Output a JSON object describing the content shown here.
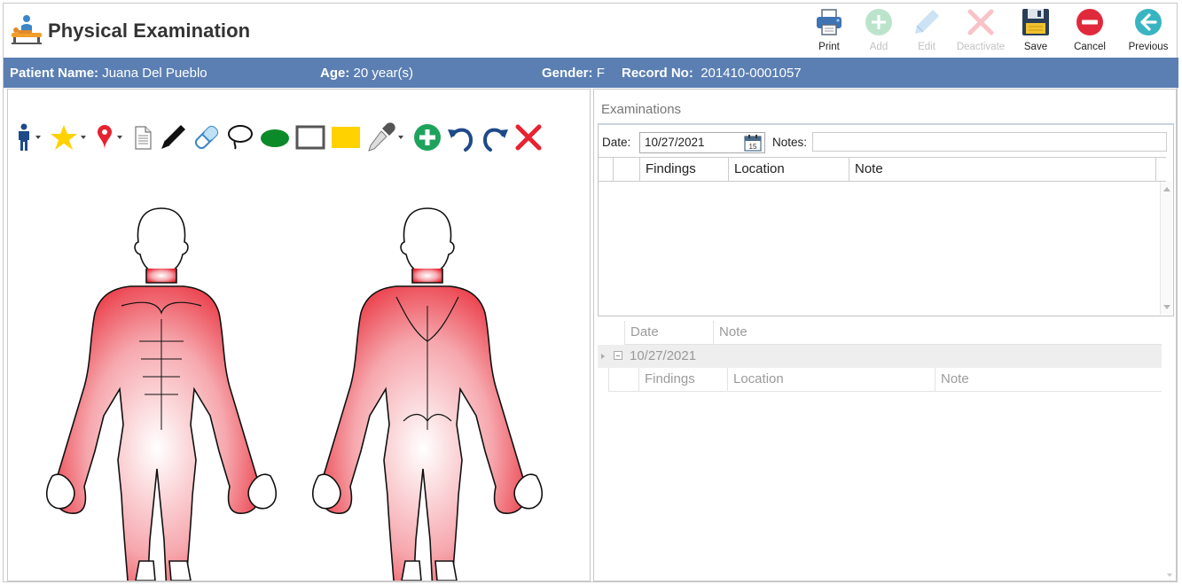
{
  "header": {
    "title": "Physical Examination",
    "toolbar": [
      {
        "name": "print-button",
        "icon": "printer-icon",
        "label": "Print",
        "enabled": true
      },
      {
        "name": "add-button",
        "icon": "plus-circle-icon",
        "label": "Add",
        "enabled": false
      },
      {
        "name": "edit-button",
        "icon": "pencil-icon",
        "label": "Edit",
        "enabled": false
      },
      {
        "name": "deactivate-button",
        "icon": "x-icon",
        "label": "Deactivate",
        "enabled": false
      },
      {
        "name": "save-button",
        "icon": "floppy-disk-icon",
        "label": "Save",
        "enabled": true
      },
      {
        "name": "cancel-button",
        "icon": "minus-circle-icon",
        "label": "Cancel",
        "enabled": true
      },
      {
        "name": "previous-button",
        "icon": "arrow-left-circle-icon",
        "label": "Previous",
        "enabled": true
      }
    ]
  },
  "patient": {
    "name_label": "Patient Name:",
    "name_value": "Juana Del Pueblo",
    "age_label": "Age:",
    "age_value": "20 year(s)",
    "gender_label": "Gender:",
    "gender_value": "F",
    "record_label": "Record No:",
    "record_value": "201410-0001057"
  },
  "drawing_tools": [
    {
      "name": "body-figure-tool",
      "icon": "person-icon",
      "dropdown": true
    },
    {
      "name": "star-tool",
      "icon": "star-icon",
      "dropdown": true
    },
    {
      "name": "pin-tool",
      "icon": "map-pin-icon",
      "dropdown": true
    },
    {
      "name": "note-tool",
      "icon": "document-icon",
      "dropdown": false
    },
    {
      "name": "marker-tool",
      "icon": "marker-icon",
      "dropdown": false
    },
    {
      "name": "eraser-tool",
      "icon": "eraser-icon",
      "dropdown": false
    },
    {
      "name": "lasso-tool",
      "icon": "lasso-icon",
      "dropdown": false
    },
    {
      "name": "ellipse-tool",
      "icon": "ellipse-icon",
      "dropdown": false
    },
    {
      "name": "rectangle-tool",
      "icon": "rectangle-icon",
      "dropdown": false
    },
    {
      "name": "fill-rectangle-tool",
      "icon": "filled-rectangle-icon",
      "dropdown": false
    },
    {
      "name": "color-picker-tool",
      "icon": "eyedropper-icon",
      "dropdown": true
    },
    {
      "name": "zoom-in-tool",
      "icon": "plus-circle-icon",
      "dropdown": false
    },
    {
      "name": "undo-tool",
      "icon": "undo-icon",
      "dropdown": false
    },
    {
      "name": "redo-tool",
      "icon": "redo-icon",
      "dropdown": false
    },
    {
      "name": "clear-tool",
      "icon": "x-icon",
      "dropdown": false
    }
  ],
  "examinations": {
    "title": "Examinations",
    "date_label": "Date:",
    "date_value": "10/27/2021",
    "notes_label": "Notes:",
    "notes_value": "",
    "columns": [
      "Findings",
      "Location",
      "Note"
    ],
    "rows": []
  },
  "history": {
    "columns": [
      "Date",
      "Note"
    ],
    "groups": [
      {
        "date": "10/27/2021",
        "sub_columns": [
          "Findings",
          "Location",
          "Note"
        ]
      }
    ]
  },
  "colors": {
    "patient_bar": "#5b7fb3",
    "muscle_red": "#e8222f",
    "accent_green": "#1fa35c",
    "cancel_red": "#e02a3c",
    "previous_teal": "#39b5c2"
  }
}
